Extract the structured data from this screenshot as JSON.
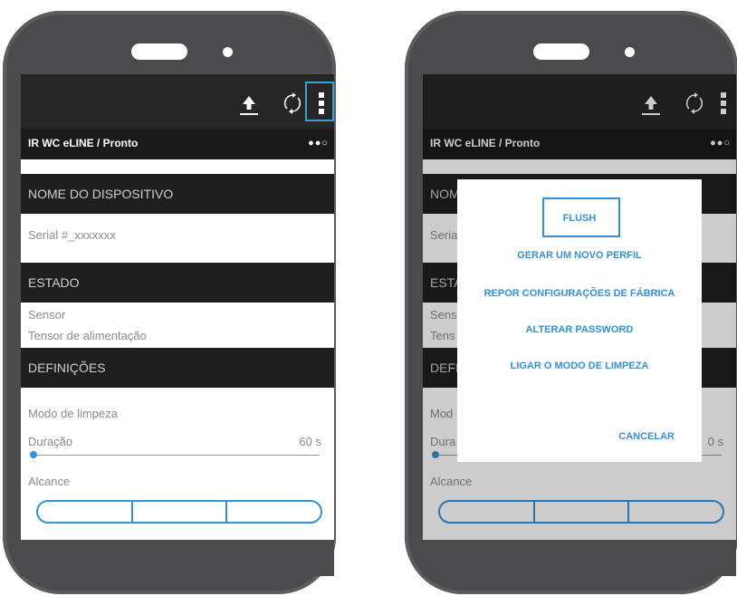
{
  "left_phone": {
    "header_title": "IR WC eLINE / Pronto",
    "more_icon": "●●○",
    "sections": {
      "device_name": "NOME DO DISPOSITIVO",
      "state": "ESTADO",
      "settings": "DEFINIÇÕES"
    },
    "serial_value": "Serial #_xxxxxxx",
    "state_rows": [
      "Sensor",
      "Tensor de alimentação"
    ],
    "settings_rows": {
      "cleaning_mode": "Modo de limpeza",
      "duration_label": "Duração",
      "duration_value": "60 s",
      "range_label": "Alcance"
    },
    "slider_fraction": 0.0,
    "segment_count": 3,
    "icons": [
      "upload-icon",
      "refresh-icon",
      "menu-icon"
    ],
    "accent": "#3a8fd0"
  },
  "right_phone": {
    "header_title": "IR WC eLINE / Pronto",
    "more_icon": "●●○",
    "dialog": {
      "items": [
        "FLUSH",
        "GERAR UM NOVO PERFIL",
        "REPOR CONFIGURAÇÕES DE FÁBRICA",
        "ALTERAR PASSWORD",
        "LIGAR O MODO DE LIMPEZA"
      ],
      "cancel": "CANCELAR"
    },
    "bg_visible": {
      "device_name": "NOM",
      "serial": "Seria",
      "state": "ESTA",
      "sensor": "Sens",
      "tensor": "Tens",
      "settings": "DEFI",
      "cleaning": "Mod",
      "duration": "Dura",
      "duration_value": "0 s",
      "range": "Alcance"
    }
  }
}
